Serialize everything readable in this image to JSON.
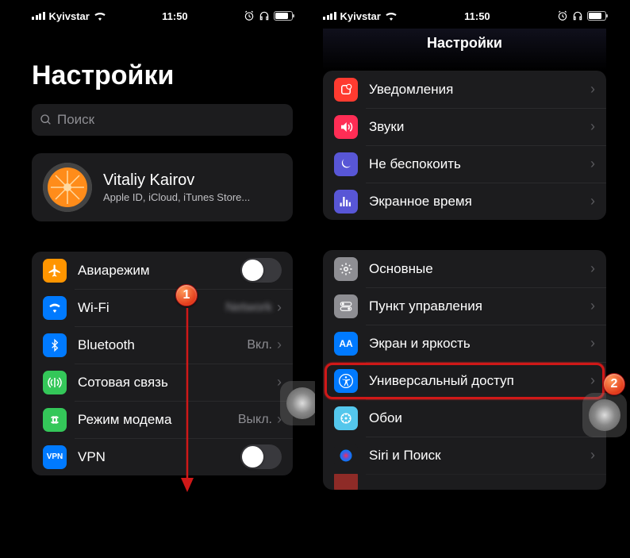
{
  "status": {
    "carrier": "Kyivstar",
    "time": "11:50"
  },
  "left": {
    "title": "Настройки",
    "search_placeholder": "Поиск",
    "profile": {
      "name": "Vitaliy Kairov",
      "sub": "Apple ID, iCloud, iTunes Store..."
    },
    "rows": {
      "airplane": "Авиарежим",
      "wifi": "Wi-Fi",
      "bluetooth": "Bluetooth",
      "bluetooth_val": "Вкл.",
      "cellular": "Сотовая связь",
      "hotspot": "Режим модема",
      "hotspot_val": "Выкл.",
      "vpn": "VPN"
    },
    "vpn_badge": "VPN"
  },
  "right": {
    "header": "Настройки",
    "group1": {
      "notifications": "Уведомления",
      "sounds": "Звуки",
      "dnd": "Не беспокоить",
      "screentime": "Экранное время"
    },
    "group2": {
      "general": "Основные",
      "control": "Пункт управления",
      "display": "Экран и яркость",
      "accessibility": "Универсальный доступ",
      "wallpaper": "Обои",
      "siri": "Siri и Поиск"
    }
  },
  "icons": {
    "airplane": "#ff9500",
    "wifi": "#007aff",
    "bluetooth": "#007aff",
    "cellular": "#34c759",
    "hotspot": "#34c759",
    "vpn": "#007aff",
    "notifications": "#ff3b30",
    "sounds": "#ff2d55",
    "dnd": "#5856d6",
    "screentime": "#5856d6",
    "general": "#8e8e93",
    "control": "#8e8e93",
    "display": "#007aff",
    "accessibility": "#007aff",
    "wallpaper": "#54c7ec",
    "siri": "#1c1c1e"
  },
  "steps": {
    "one": "1",
    "two": "2"
  }
}
